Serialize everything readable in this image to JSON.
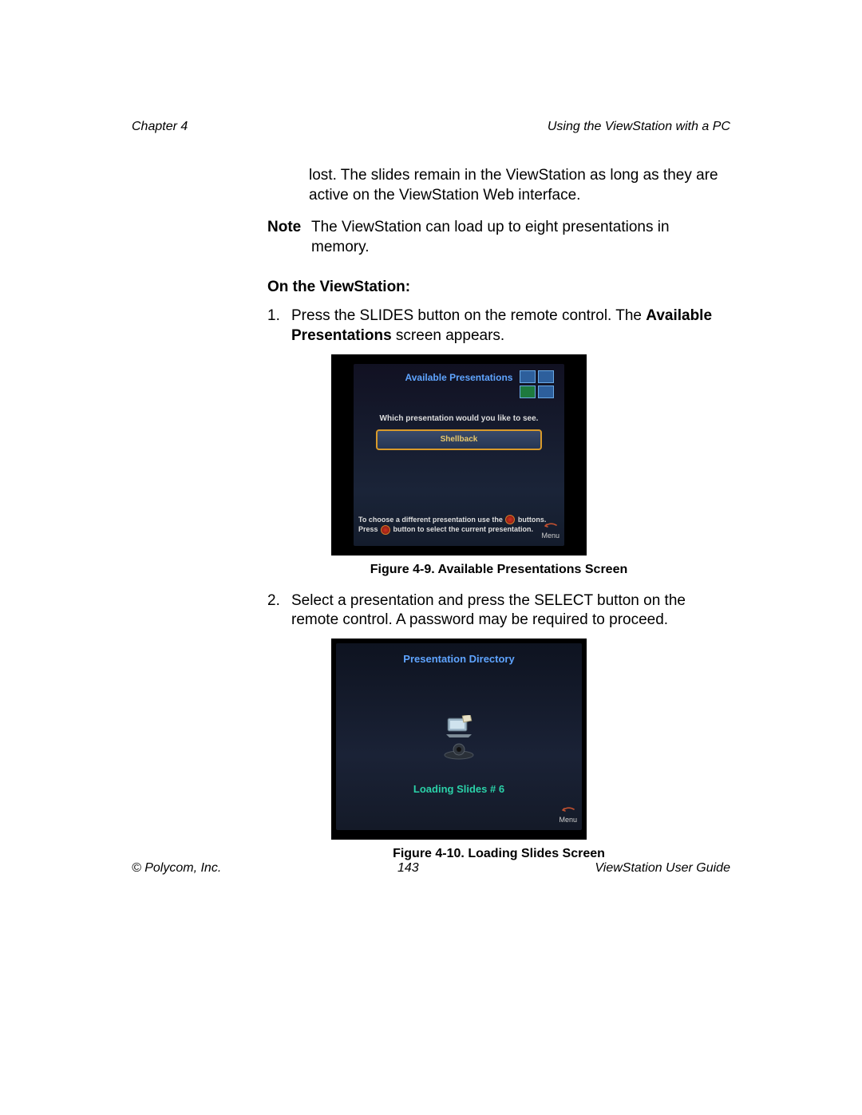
{
  "header": {
    "left": "Chapter 4",
    "right": "Using the ViewStation with a PC"
  },
  "paragraph_fragment": "lost. The slides remain in the ViewStation as long as they are active on the ViewStation Web interface.",
  "note": {
    "label": "Note",
    "text": "The ViewStation can load up to eight presentations in memory."
  },
  "section_heading": "On the ViewStation:",
  "steps": [
    {
      "marker": "1.",
      "pre": "Press the SLIDES button on the remote control. The ",
      "bold1": "Available Presentations",
      "post": " screen appears."
    },
    {
      "marker": "2.",
      "text": "Select a presentation and press the SELECT button on the remote control. A password may be required to proceed."
    }
  ],
  "figure1": {
    "title": "Available Presentations",
    "prompt": "Which presentation would you like to see.",
    "selected_item": "Shellback",
    "hint_line1_a": "To choose a different presentation use the ",
    "hint_line1_b": " buttons.",
    "hint_line2_a": "Press ",
    "hint_line2_b": " button to select the current presentation.",
    "menu_label": "Menu",
    "caption": "Figure 4-9.  Available Presentations Screen"
  },
  "figure2": {
    "title": "Presentation Directory",
    "loading_text": "Loading Slides # 6",
    "menu_label": "Menu",
    "caption": "Figure 4-10.  Loading Slides Screen"
  },
  "footer": {
    "left": "© Polycom, Inc.",
    "center": "143",
    "right": "ViewStation User Guide"
  }
}
